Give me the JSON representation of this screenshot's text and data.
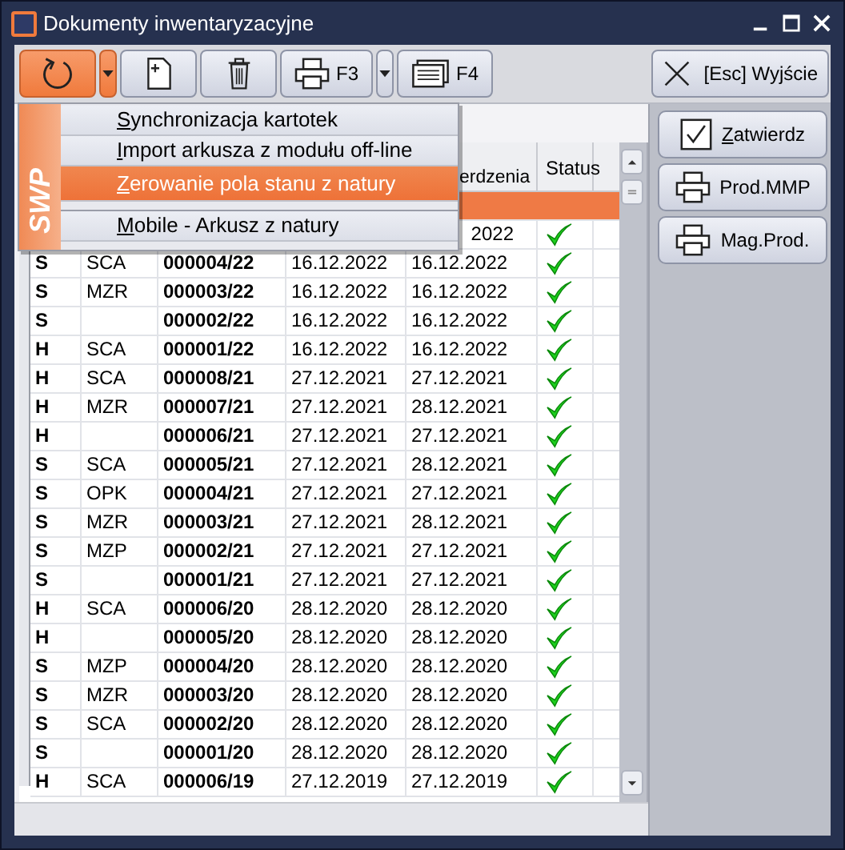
{
  "window": {
    "title": "Dokumenty inwentaryzacyjne"
  },
  "toolbar": [
    {
      "kind": "refresh",
      "active": true
    },
    {
      "kind": "dropdown",
      "active": true
    },
    {
      "kind": "new"
    },
    {
      "kind": "delete"
    },
    {
      "kind": "print",
      "label": "F3"
    },
    {
      "kind": "dropdown",
      "active": false
    },
    {
      "kind": "card",
      "label": "F4"
    }
  ],
  "exit_button": {
    "label": "[Esc] Wyjście"
  },
  "side_buttons": [
    {
      "kind": "check",
      "label": "Zatwierdz",
      "underline_first": true
    },
    {
      "kind": "print",
      "label": "Prod.MMP",
      "underline_first": false
    },
    {
      "kind": "print",
      "label": "Mag.Prod.",
      "underline_first": false
    }
  ],
  "menu": {
    "brand": "SWP",
    "items": [
      {
        "kind": "item",
        "label": "Synchronizacja kartotek",
        "underline_first": true,
        "selected": false
      },
      {
        "kind": "item",
        "label": "Import arkusza z modułu off-line",
        "underline_first": true,
        "selected": false
      },
      {
        "kind": "item",
        "label": "Zerowanie pola stanu z natury",
        "underline_first": true,
        "selected": true
      },
      {
        "kind": "separator"
      },
      {
        "kind": "item",
        "label": "Mobile - Arkusz z natury",
        "underline_first": true,
        "selected": false
      }
    ]
  },
  "table": {
    "columns": [
      "",
      "",
      "",
      "",
      "erdzenia",
      "Status"
    ],
    "rows": [
      {
        "selected": true,
        "cells": [
          "",
          "",
          "",
          "",
          ""
        ],
        "checked": false
      },
      {
        "selected": false,
        "cells": [
          "",
          "",
          "",
          "",
          "2022"
        ],
        "checked": true
      },
      {
        "selected": false,
        "cells": [
          "S",
          "SCA",
          "000004/22",
          "16.12.2022",
          "16.12.2022"
        ],
        "checked": true
      },
      {
        "selected": false,
        "cells": [
          "S",
          "MZR",
          "000003/22",
          "16.12.2022",
          "16.12.2022"
        ],
        "checked": true
      },
      {
        "selected": false,
        "cells": [
          "S",
          "",
          "000002/22",
          "16.12.2022",
          "16.12.2022"
        ],
        "checked": true
      },
      {
        "selected": false,
        "cells": [
          "H",
          "SCA",
          "000001/22",
          "16.12.2022",
          "16.12.2022"
        ],
        "checked": true
      },
      {
        "selected": false,
        "cells": [
          "H",
          "SCA",
          "000008/21",
          "27.12.2021",
          "27.12.2021"
        ],
        "checked": true
      },
      {
        "selected": false,
        "cells": [
          "H",
          "MZR",
          "000007/21",
          "27.12.2021",
          "28.12.2021"
        ],
        "checked": true
      },
      {
        "selected": false,
        "cells": [
          "H",
          "",
          "000006/21",
          "27.12.2021",
          "27.12.2021"
        ],
        "checked": true
      },
      {
        "selected": false,
        "cells": [
          "S",
          "SCA",
          "000005/21",
          "27.12.2021",
          "28.12.2021"
        ],
        "checked": true
      },
      {
        "selected": false,
        "cells": [
          "S",
          "OPK",
          "000004/21",
          "27.12.2021",
          "27.12.2021"
        ],
        "checked": true
      },
      {
        "selected": false,
        "cells": [
          "S",
          "MZR",
          "000003/21",
          "27.12.2021",
          "28.12.2021"
        ],
        "checked": true
      },
      {
        "selected": false,
        "cells": [
          "S",
          "MZP",
          "000002/21",
          "27.12.2021",
          "27.12.2021"
        ],
        "checked": true
      },
      {
        "selected": false,
        "cells": [
          "S",
          "",
          "000001/21",
          "27.12.2021",
          "27.12.2021"
        ],
        "checked": true
      },
      {
        "selected": false,
        "cells": [
          "H",
          "SCA",
          "000006/20",
          "28.12.2020",
          "28.12.2020"
        ],
        "checked": true
      },
      {
        "selected": false,
        "cells": [
          "H",
          "",
          "000005/20",
          "28.12.2020",
          "28.12.2020"
        ],
        "checked": true
      },
      {
        "selected": false,
        "cells": [
          "S",
          "MZP",
          "000004/20",
          "28.12.2020",
          "28.12.2020"
        ],
        "checked": true
      },
      {
        "selected": false,
        "cells": [
          "S",
          "MZR",
          "000003/20",
          "28.12.2020",
          "28.12.2020"
        ],
        "checked": true
      },
      {
        "selected": false,
        "cells": [
          "S",
          "SCA",
          "000002/20",
          "28.12.2020",
          "28.12.2020"
        ],
        "checked": true
      },
      {
        "selected": false,
        "cells": [
          "S",
          "",
          "000001/20",
          "28.12.2020",
          "28.12.2020"
        ],
        "checked": true
      },
      {
        "selected": false,
        "cells": [
          "H",
          "SCA",
          "000006/19",
          "27.12.2019",
          "27.12.2019"
        ],
        "checked": true
      }
    ]
  }
}
